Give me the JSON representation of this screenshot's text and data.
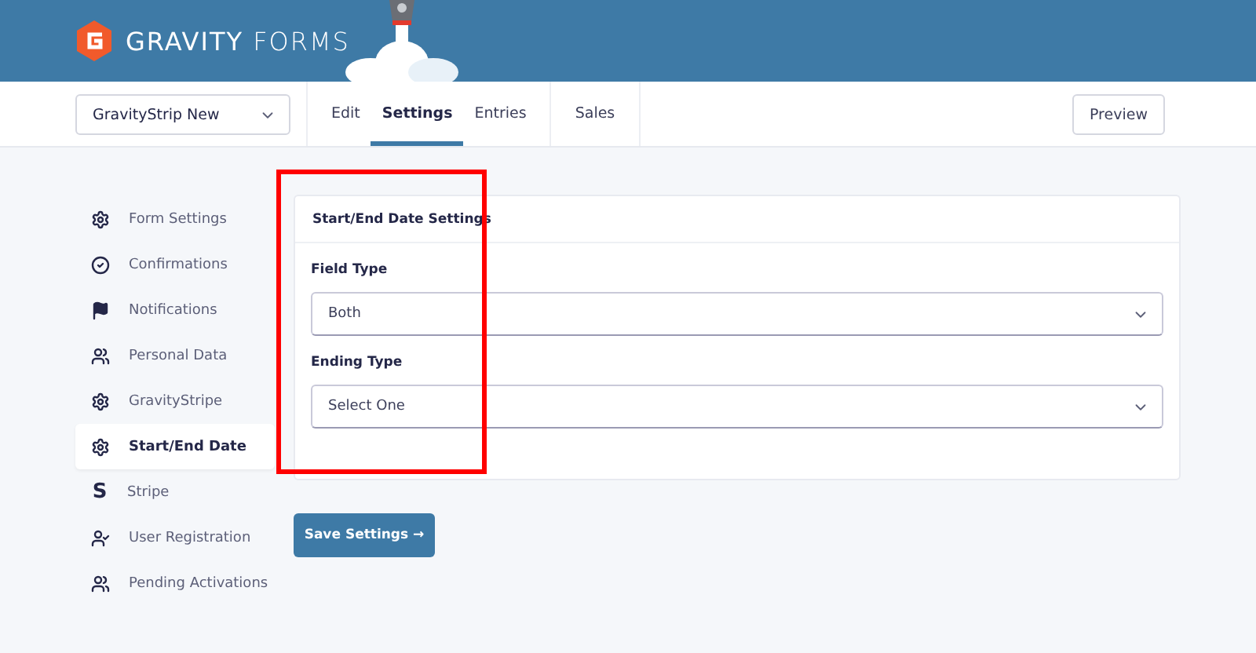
{
  "header": {
    "logo": "**GRAVITY** FORMS"
  },
  "nav": {
    "form_select": {
      "value": "GravityStrip New"
    },
    "tabs": [
      {
        "label": "Edit",
        "selected": false
      },
      {
        "label": "Settings",
        "selected": true
      },
      {
        "label": "Entries",
        "selected": false
      },
      {
        "label": "Sales",
        "selected": false
      }
    ],
    "preview_button": "Preview"
  },
  "sidebar": {
    "items": [
      {
        "label": "Form Settings",
        "kind": "gear",
        "selected": false
      },
      {
        "label": "Confirmations",
        "kind": "check",
        "selected": false
      },
      {
        "label": "Notifications",
        "kind": "flag",
        "selected": false
      },
      {
        "label": "Personal Data",
        "kind": "people",
        "selected": false
      },
      {
        "label": "GravityStripe",
        "kind": "gear",
        "selected": false
      },
      {
        "label": "Start/End Date",
        "kind": "gear",
        "selected": true
      },
      {
        "label": "Stripe",
        "kind": "letter",
        "glyph": "S",
        "selected": false
      },
      {
        "label": "User Registration",
        "kind": "usercheck",
        "selected": false
      },
      {
        "label": "Pending Activations",
        "kind": "people",
        "selected": false
      }
    ]
  },
  "panel": {
    "title": "Start/End Date Settings",
    "fields": [
      {
        "label": "Field Type",
        "value": "Both"
      },
      {
        "label": "Ending Type",
        "value": "Select One"
      }
    ]
  },
  "save_button": "Save Settings →",
  "annotation": {
    "kind": "highlight"
  }
}
